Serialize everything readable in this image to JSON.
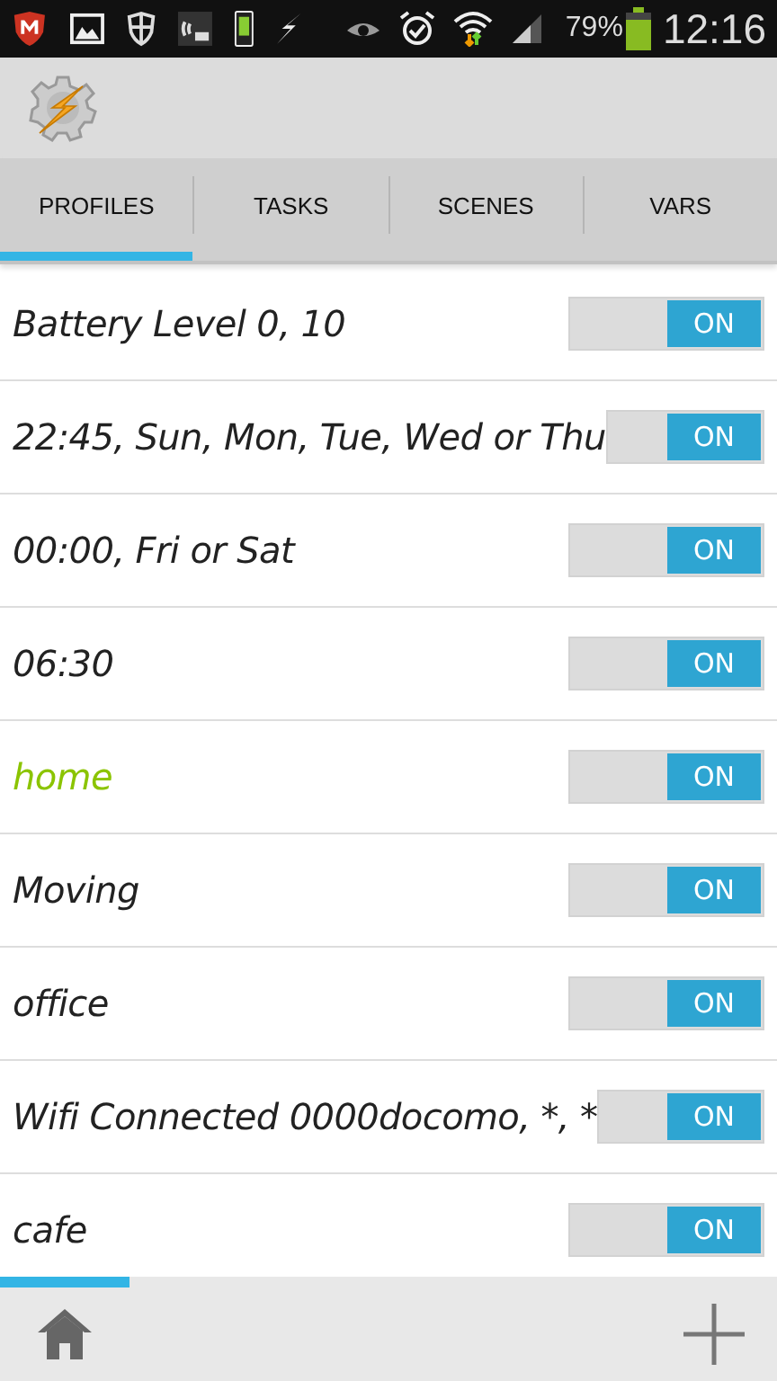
{
  "status_bar": {
    "battery_text": "79%",
    "time": "12:16"
  },
  "tabs": [
    {
      "label": "PROFILES",
      "selected": true
    },
    {
      "label": "TASKS",
      "selected": false
    },
    {
      "label": "SCENES",
      "selected": false
    },
    {
      "label": "VARS",
      "selected": false
    }
  ],
  "profiles": [
    {
      "name": "Battery Level 0, 10",
      "active": false,
      "on": true,
      "toggle_label": "ON"
    },
    {
      "name": "22:45, Sun, Mon, Tue, Wed or Thu",
      "active": false,
      "on": true,
      "toggle_label": "ON"
    },
    {
      "name": "00:00, Fri or Sat",
      "active": false,
      "on": true,
      "toggle_label": "ON"
    },
    {
      "name": "06:30",
      "active": false,
      "on": true,
      "toggle_label": "ON"
    },
    {
      "name": "home",
      "active": true,
      "on": true,
      "toggle_label": "ON"
    },
    {
      "name": "Moving",
      "active": false,
      "on": true,
      "toggle_label": "ON"
    },
    {
      "name": "office",
      "active": false,
      "on": true,
      "toggle_label": "ON"
    },
    {
      "name": "Wifi Connected 0000docomo, *, *",
      "active": false,
      "on": true,
      "toggle_label": "ON"
    },
    {
      "name": "cafe",
      "active": false,
      "on": true,
      "toggle_label": "ON"
    }
  ]
}
